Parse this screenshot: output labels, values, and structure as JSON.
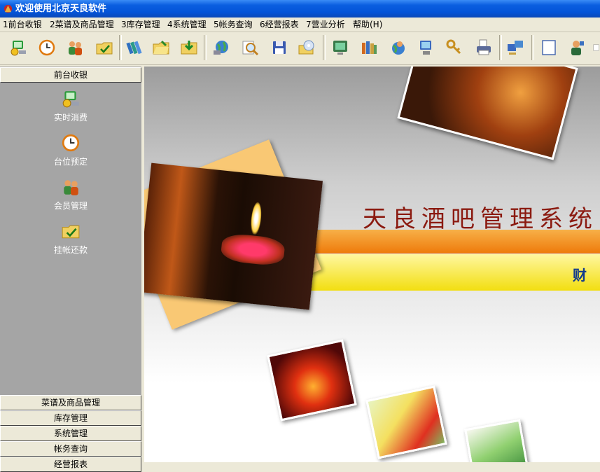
{
  "window": {
    "title": "欢迎使用北京天良软件"
  },
  "menu": [
    {
      "label": "1前台收银"
    },
    {
      "label": "2菜谱及商品管理"
    },
    {
      "label": "3库存管理"
    },
    {
      "label": "4系统管理"
    },
    {
      "label": "5帐务查询"
    },
    {
      "label": "6经营报表"
    },
    {
      "label": "7营业分析"
    },
    {
      "label": "帮助(H)"
    }
  ],
  "toolbar": {
    "icons": [
      "computer-coin-icon",
      "clock-icon",
      "members-icon",
      "folder-check-icon",
      "books-icon",
      "folder-open-icon",
      "folder-arrow-icon",
      "globe-icon",
      "magnifier-icon",
      "floppy-disk-icon",
      "cd-folder-icon",
      "monitor-icon",
      "library-icon",
      "user-globe-icon",
      "network-computer-icon",
      "keys-icon",
      "printer-icon",
      "computers-icon",
      "blank-page-icon",
      "support-user-icon"
    ]
  },
  "sidebar": {
    "active_group": "前台收银",
    "items": [
      {
        "label": "实时消费",
        "icon": "computer-coin-icon"
      },
      {
        "label": "台位预定",
        "icon": "clock-icon"
      },
      {
        "label": "会员管理",
        "icon": "members-icon"
      },
      {
        "label": "挂帐还款",
        "icon": "folder-check-icon"
      }
    ],
    "groups": [
      "菜谱及商品管理",
      "库存管理",
      "系统管理",
      "帐务查询",
      "经营报表"
    ]
  },
  "banner": {
    "title": "天良酒吧管理系统",
    "subtitle": "财"
  },
  "colors": {
    "titlebar": "#0454d8",
    "sidebar": "#a5a5a5",
    "orange_band": "#f08a10",
    "yellow_band": "#f2e000",
    "title_text": "#8b1a10"
  }
}
